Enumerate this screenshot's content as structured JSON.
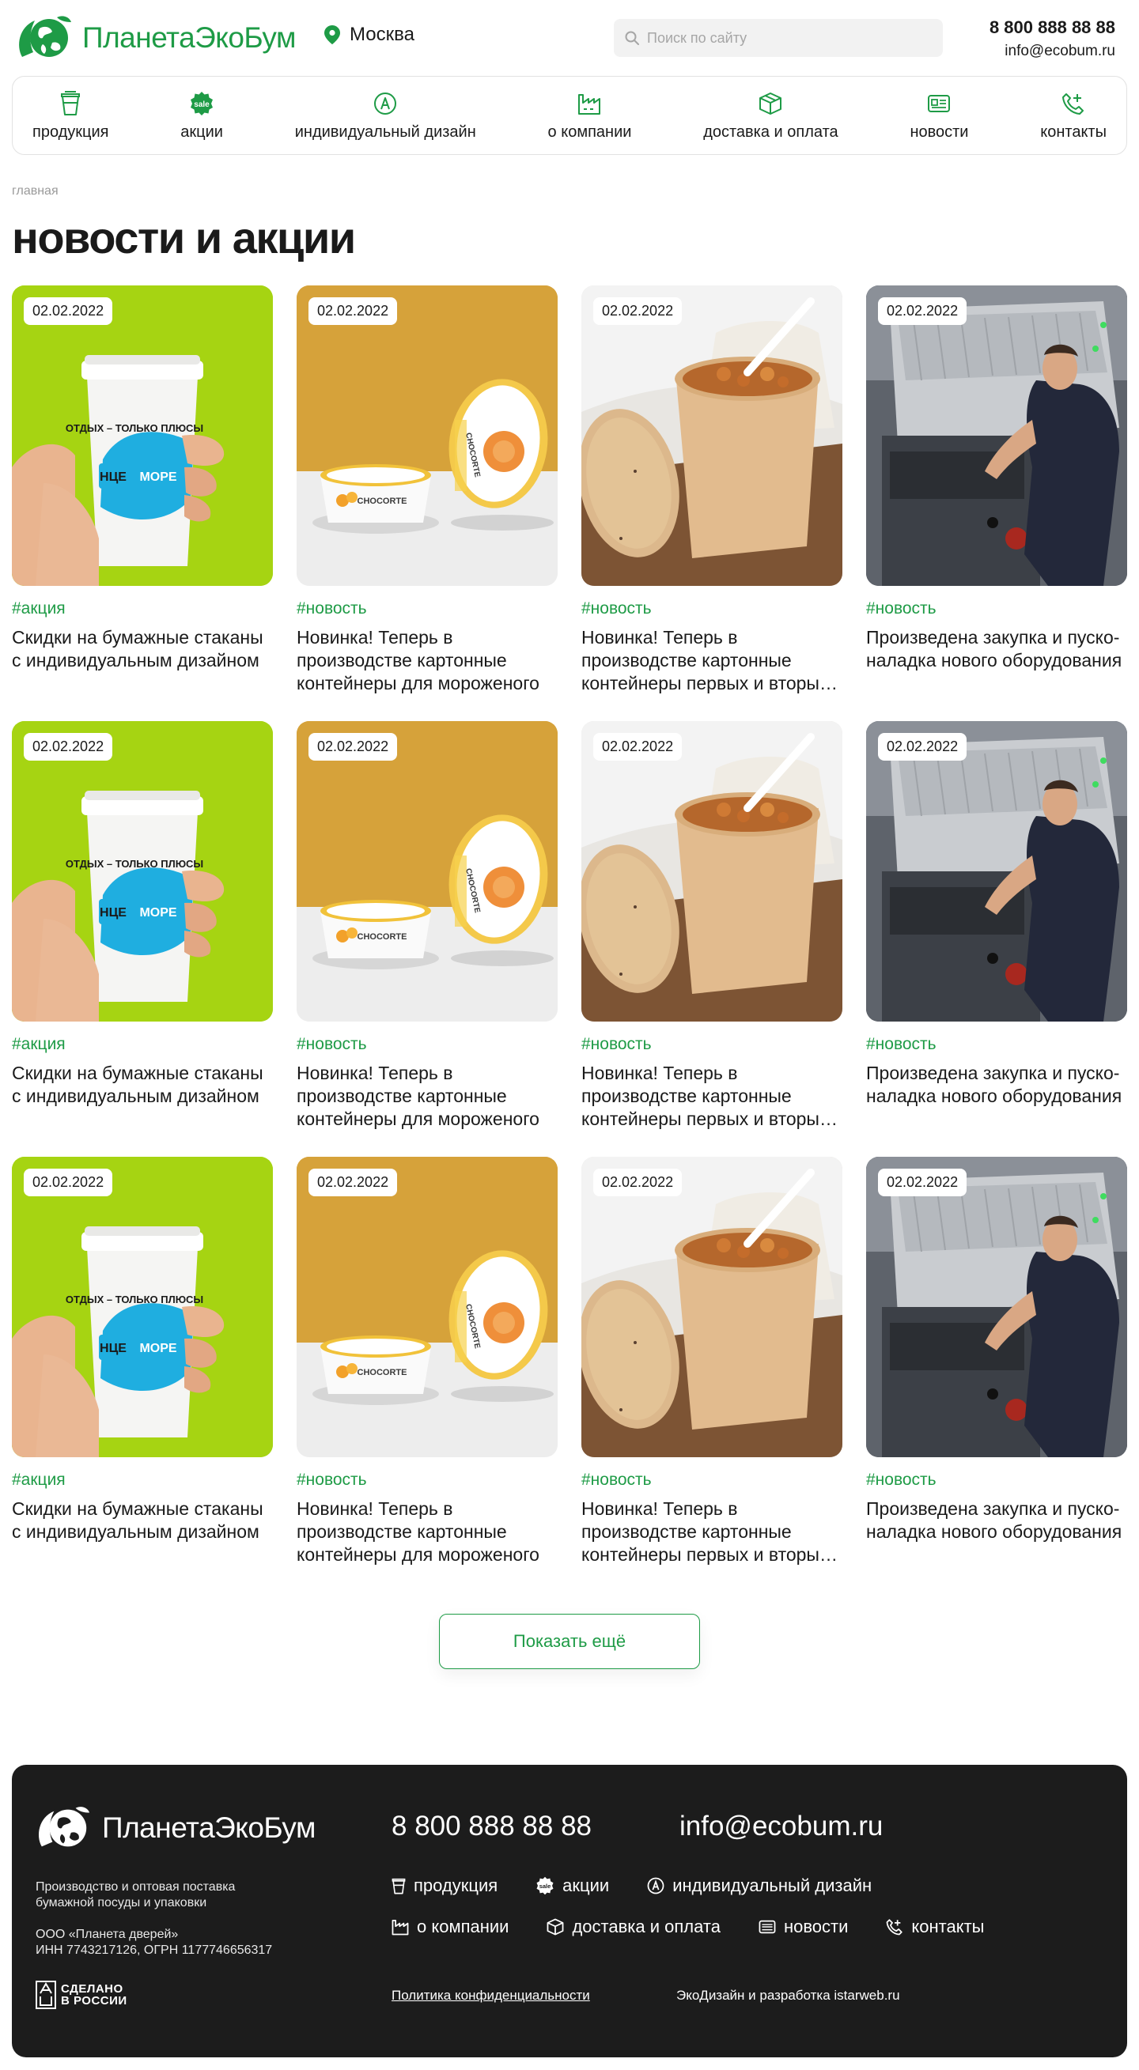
{
  "header": {
    "brand": "ПланетаЭкоБум",
    "city": "Москва",
    "search_placeholder": "Поиск по сайту",
    "phone": "8 800 888 88 88",
    "email": "info@ecobum.ru"
  },
  "nav": {
    "items": [
      {
        "label": "продукция",
        "icon": "cup-icon"
      },
      {
        "label": "акции",
        "icon": "sale-icon"
      },
      {
        "label": "индивидуальный дизайн",
        "icon": "design-icon"
      },
      {
        "label": "о компании",
        "icon": "factory-icon"
      },
      {
        "label": "доставка и оплата",
        "icon": "box-icon"
      },
      {
        "label": "новости",
        "icon": "news-icon"
      },
      {
        "label": "контакты",
        "icon": "phone-plus-icon"
      }
    ],
    "sale_badge": "sale"
  },
  "breadcrumb": "главная",
  "page_title": "новости и акции",
  "cards": [
    {
      "date": "02.02.2022",
      "tag": "#акция",
      "title": "Скидки на бумажные стаканы с индивидуальным дизайном",
      "image": "cup",
      "cup_text": "ОТДЫХ – ТОЛЬКО ПЛЮСЫ",
      "cup_text2": "МОРЕ",
      "cup_text3": "НЦЕ"
    },
    {
      "date": "02.02.2022",
      "tag": "#новость",
      "title": "Новинка! Теперь в производстве картонные контейнеры для мороженого",
      "image": "ice",
      "brand_text": "CHOCORTE"
    },
    {
      "date": "02.02.2022",
      "tag": "#новость",
      "title": "Новинка! Теперь в производстве картонные контейнеры первых и вторых блюд",
      "image": "soup"
    },
    {
      "date": "02.02.2022",
      "tag": "#новость",
      "title": "Произведена закупка и пуско-наладка нового оборудования",
      "image": "factory"
    },
    {
      "date": "02.02.2022",
      "tag": "#акция",
      "title": "Скидки на бумажные стаканы с индивидуальным дизайном",
      "image": "cup",
      "cup_text": "ОТДЫХ – ТОЛЬКО ПЛЮСЫ",
      "cup_text2": "МОРЕ",
      "cup_text3": "НЦЕ"
    },
    {
      "date": "02.02.2022",
      "tag": "#новость",
      "title": "Новинка! Теперь в производстве картонные контейнеры для мороженого",
      "image": "ice",
      "brand_text": "CHOCORTE"
    },
    {
      "date": "02.02.2022",
      "tag": "#новость",
      "title": "Новинка! Теперь в производстве картонные контейнеры первых и вторых блюд",
      "image": "soup"
    },
    {
      "date": "02.02.2022",
      "tag": "#новость",
      "title": "Произведена закупка и пуско-наладка нового оборудования",
      "image": "factory"
    },
    {
      "date": "02.02.2022",
      "tag": "#акция",
      "title": "Скидки на бумажные стаканы с индивидуальным дизайном",
      "image": "cup",
      "cup_text": "ОТДЫХ – ТОЛЬКО ПЛЮСЫ",
      "cup_text2": "МОРЕ",
      "cup_text3": "НЦЕ"
    },
    {
      "date": "02.02.2022",
      "tag": "#новость",
      "title": "Новинка! Теперь в производстве картонные контейнеры для мороженого",
      "image": "ice",
      "brand_text": "CHOCORTE"
    },
    {
      "date": "02.02.2022",
      "tag": "#новость",
      "title": "Новинка! Теперь в производстве картонные контейнеры первых и вторых блюд",
      "image": "soup"
    },
    {
      "date": "02.02.2022",
      "tag": "#новость",
      "title": "Произведена закупка и пуско-наладка нового оборудования",
      "image": "factory"
    }
  ],
  "more_button": "Показать ещё",
  "footer": {
    "brand": "ПланетаЭкоБум",
    "description": "Производство и оптовая поставка бумажной посуды и упаковки",
    "org_line1": "ООО «Планета дверей»",
    "org_line2": "ИНН 7743217126, ОГРН 1177746656317",
    "made_in_line1": "СДЕЛАНО",
    "made_in_line2": "В РОССИИ",
    "phone": "8 800 888 88 88",
    "email": "info@ecobum.ru",
    "links_row1": [
      {
        "label": "продукция",
        "icon": "cup-icon"
      },
      {
        "label": "акции",
        "icon": "sale-icon"
      },
      {
        "label": "индивидуальный дизайн",
        "icon": "design-icon"
      }
    ],
    "links_row2": [
      {
        "label": "о компании",
        "icon": "factory-icon"
      },
      {
        "label": "доставка и оплата",
        "icon": "box-icon"
      },
      {
        "label": "новости",
        "icon": "news-icon"
      },
      {
        "label": "контакты",
        "icon": "phone-plus-icon"
      }
    ],
    "policy": "Политика конфиденциальности",
    "developer": "ЭкоДизайн и разработка istarweb.ru"
  },
  "colors": {
    "brand_green": "#1e9b46",
    "footer_bg": "#1c1c1c",
    "text": "#1a1a1a"
  }
}
